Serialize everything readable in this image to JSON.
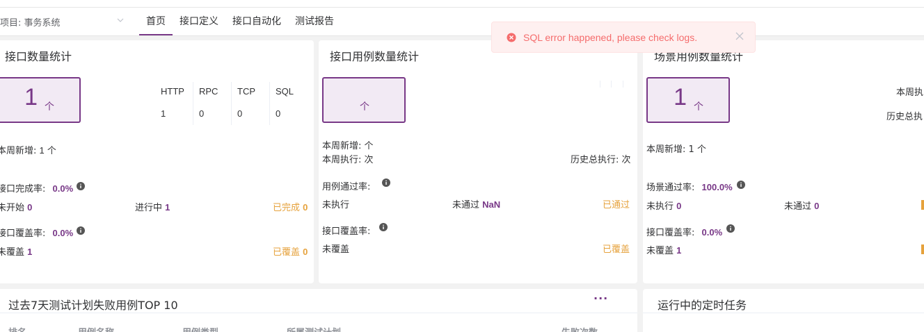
{
  "nav": {
    "project_label": "项目: 事务系统",
    "tabs": [
      {
        "label": "首页",
        "active": true
      },
      {
        "label": "接口定义"
      },
      {
        "label": "接口自动化"
      },
      {
        "label": "测试报告"
      }
    ]
  },
  "toast": {
    "message": "SQL error happened, please check logs."
  },
  "api_card": {
    "title": "接口数量统计",
    "count": "1",
    "unit": "个",
    "protocols": [
      {
        "name": "HTTP",
        "value": "1"
      },
      {
        "name": "RPC",
        "value": "0"
      },
      {
        "name": "TCP",
        "value": "0"
      },
      {
        "name": "SQL",
        "value": "0"
      }
    ],
    "week_new_label": "本周新增:",
    "week_new_value": "1",
    "week_new_unit": "个",
    "complete_rate_label": "接口完成率:",
    "complete_rate_value": "0.0%",
    "not_started_label": "未开始",
    "not_started_value": "0",
    "in_progress_label": "进行中",
    "in_progress_value": "1",
    "done_label": "已完成",
    "done_value": "0",
    "coverage_label": "接口覆盖率:",
    "coverage_value": "0.0%",
    "uncovered_label": "未覆盖",
    "uncovered_value": "1",
    "covered_label": "已覆盖",
    "covered_value": "0"
  },
  "case_card": {
    "title": "接口用例数量统计",
    "unit": "个",
    "week_new": "本周新增:  个",
    "week_exec": "本周执行: 次",
    "history_exec": "历史总执行: 次",
    "pass_rate_label": "用例通过率:",
    "not_exec_label": "未执行",
    "not_pass_label": "未通过",
    "not_pass_value": "NaN",
    "passed_label": "已通过",
    "coverage_label": "接口覆盖率:",
    "uncovered_label": "未覆盖",
    "covered_label": "已覆盖"
  },
  "scenario_card": {
    "title": "场景用例数量统计",
    "count": "1",
    "unit": "个",
    "week_exec_partial": "本周执",
    "history_exec_partial": "历史总执",
    "week_new_label": "本周新增:",
    "week_new_value": "1",
    "week_new_unit": "个",
    "pass_rate_label": "场景通过率:",
    "pass_rate_value": "100.0%",
    "not_exec_label": "未执行",
    "not_exec_value": "0",
    "not_pass_label": "未通过",
    "not_pass_value": "0",
    "coverage_label": "接口覆盖率:",
    "coverage_value": "0.0%",
    "uncovered_label": "未覆盖",
    "uncovered_value": "1"
  },
  "failed_top": {
    "title": "过去7天测试计划失败用例TOP 10",
    "more": "···",
    "columns": [
      "排名",
      "用例名称",
      "用例类型",
      "所属测试计划",
      "失败次数"
    ]
  },
  "scheduled": {
    "title": "运行中的定时任务"
  },
  "colors": {
    "accent": "#783887",
    "orange": "#e6a23c",
    "error": "#f56c6c"
  }
}
